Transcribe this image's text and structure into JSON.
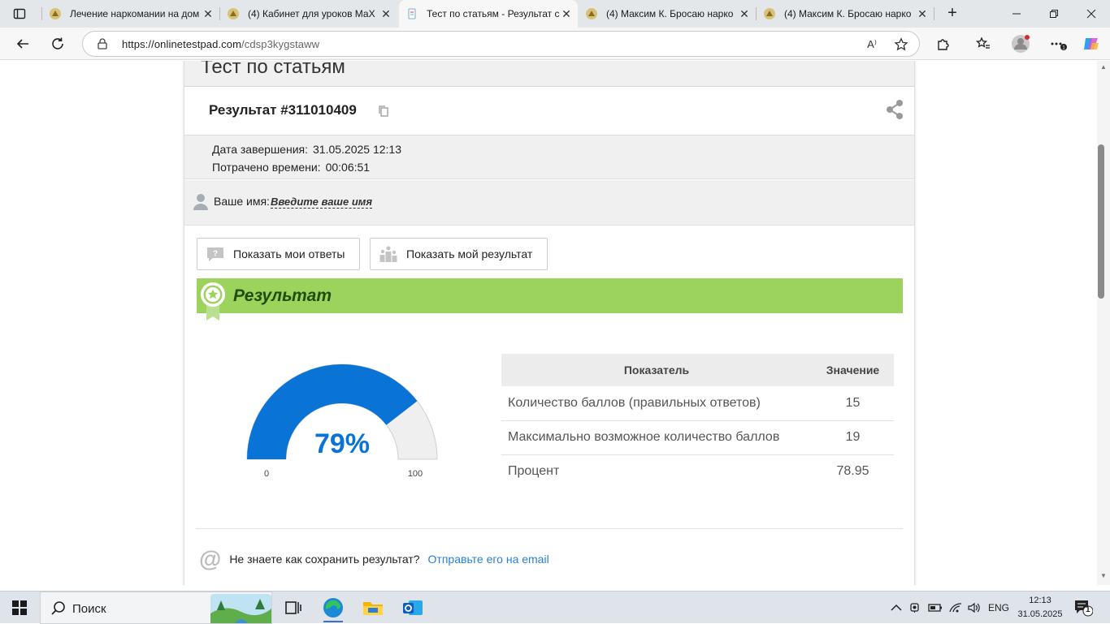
{
  "browser": {
    "tabs": [
      {
        "title": "Лечение наркомании на дом",
        "active": false
      },
      {
        "title": "(4) Кабинет для уроков МаХ",
        "active": false
      },
      {
        "title": "Тест по статьям - Результат с",
        "active": true
      },
      {
        "title": "(4) Максим К. Бросаю нарко",
        "active": false
      },
      {
        "title": "(4) Максим К. Бросаю нарко",
        "active": false
      }
    ],
    "url_host": "https://onlinetestpad.com",
    "url_path": "/cdsp3kygstaww"
  },
  "page": {
    "test_title": "Тест по статьям",
    "result_label": "Результат #311010409",
    "completion_label": "Дата завершения:",
    "completion_value": "31.05.2025 12:13",
    "time_label": "Потрачено времени:",
    "time_value": "00:06:51",
    "name_label": "Ваше имя:",
    "name_value": "Введите ваше имя",
    "btn_answers": "Показать мои ответы",
    "btn_result": "Показать мой результат",
    "banner": "Результат",
    "gauge": {
      "value": 79,
      "display": "79%",
      "min": "0",
      "max": "100",
      "color": "#0a74d6"
    },
    "table": {
      "headers": [
        "Показатель",
        "Значение"
      ],
      "rows": [
        [
          "Количество баллов (правильных ответов)",
          "15"
        ],
        [
          "Максимально возможное количество баллов",
          "19"
        ],
        [
          "Процент",
          "78.95"
        ]
      ]
    },
    "save_question": "Не знаете как сохранить результат?",
    "save_link": "Отправьте его на email"
  },
  "taskbar": {
    "search": "Поиск",
    "lang": "ENG",
    "time": "12:13",
    "date": "31.05.2025",
    "notif_count": "1"
  }
}
